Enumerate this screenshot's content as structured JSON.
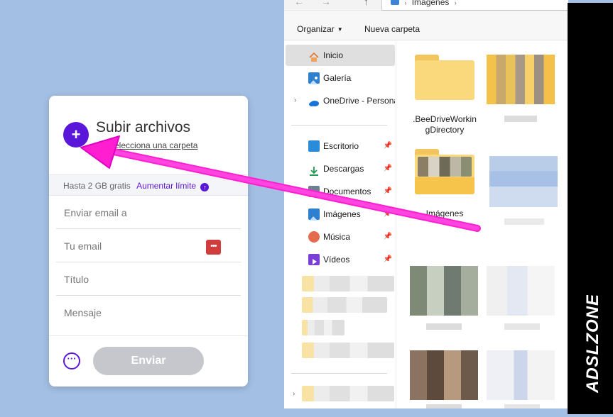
{
  "upload_card": {
    "title": "Subir archivos",
    "add_symbol": "+",
    "folder_link": "o selecciona una carpeta",
    "limit_text": "Hasta 2 GB gratis",
    "limit_link": "Aumentar límite",
    "fields": {
      "send_to": "Enviar email a",
      "your_email": "Tu email",
      "title": "Título",
      "message": "Mensaje"
    },
    "send_button": "Enviar",
    "more_symbol": "···",
    "field_icon_symbol": "•••",
    "accent_color": "#5b17d9"
  },
  "explorer": {
    "address": "Imágenes",
    "toolbar": {
      "organize": "Organizar",
      "new_folder": "Nueva carpeta"
    },
    "nav_items": [
      {
        "label": "Inicio",
        "icon": "home-icon",
        "selected": true
      },
      {
        "label": "Galería",
        "icon": "gallery-icon"
      },
      {
        "label": "OneDrive - Persona",
        "icon": "cloud-icon",
        "expandable": true
      },
      {
        "label": "Escritorio",
        "icon": "desktop-icon",
        "pinned": true
      },
      {
        "label": "Descargas",
        "icon": "download-icon",
        "pinned": true
      },
      {
        "label": "Documentos",
        "icon": "document-icon",
        "pinned": true
      },
      {
        "label": "Imágenes",
        "icon": "pictures-icon",
        "pinned": true
      },
      {
        "label": "Música",
        "icon": "music-icon",
        "pinned": true
      },
      {
        "label": "Vídeos",
        "icon": "video-icon",
        "pinned": true
      }
    ],
    "tiles": [
      {
        "label": ".BeeDriveWorkingDirectory",
        "type": "folder"
      },
      {
        "label": "Imágenes",
        "type": "folder-with-photos"
      }
    ]
  },
  "watermark": "ADSLZONE"
}
